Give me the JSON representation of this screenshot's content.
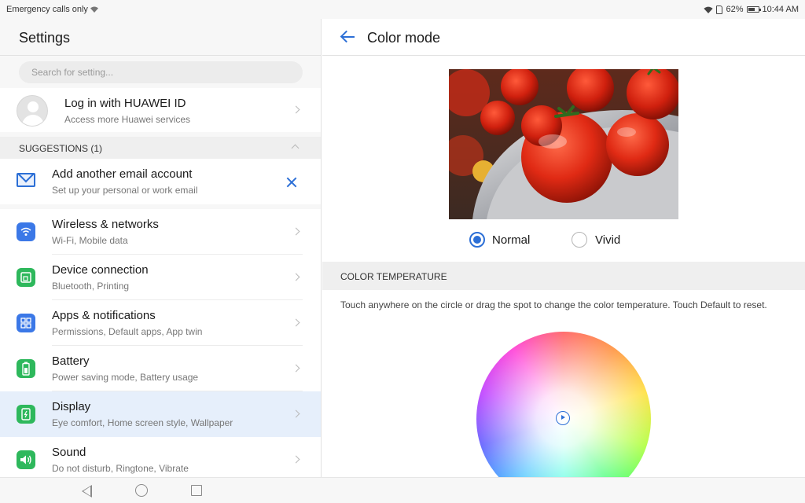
{
  "status_bar": {
    "left_text": "Emergency calls only",
    "battery": "62%",
    "time": "10:44 AM"
  },
  "left_pane": {
    "title": "Settings",
    "search_placeholder": "Search for setting...",
    "account": {
      "title": "Log in with HUAWEI ID",
      "subtitle": "Access more Huawei services"
    },
    "suggestions": {
      "header": "SUGGESTIONS (1)",
      "items": [
        {
          "title": "Add another email account",
          "subtitle": "Set up your personal or work email"
        }
      ]
    },
    "menu": [
      {
        "title": "Wireless & networks",
        "subtitle": "Wi-Fi, Mobile data",
        "icon": "wifi-icon",
        "color": "#3b78e7"
      },
      {
        "title": "Device connection",
        "subtitle": "Bluetooth, Printing",
        "icon": "device-connection-icon",
        "color": "#2eb85c"
      },
      {
        "title": "Apps & notifications",
        "subtitle": "Permissions, Default apps, App twin",
        "icon": "apps-icon",
        "color": "#3b78e7"
      },
      {
        "title": "Battery",
        "subtitle": "Power saving mode, Battery usage",
        "icon": "battery-icon",
        "color": "#2eb85c"
      },
      {
        "title": "Display",
        "subtitle": "Eye comfort, Home screen style, Wallpaper",
        "icon": "display-icon",
        "color": "#2eb85c",
        "selected": true
      },
      {
        "title": "Sound",
        "subtitle": "Do not disturb, Ringtone, Vibrate",
        "icon": "sound-icon",
        "color": "#2eb85c"
      }
    ]
  },
  "right_pane": {
    "title": "Color mode",
    "preview_image": "tomatoes-in-colander",
    "color_mode_options": [
      {
        "label": "Normal",
        "selected": true
      },
      {
        "label": "Vivid",
        "selected": false
      }
    ],
    "color_temperature": {
      "header": "COLOR TEMPERATURE",
      "description": "Touch anywhere on the circle or drag the spot to change the color temperature. Touch Default to reset."
    }
  },
  "colors": {
    "accent": "#2c6fd6",
    "selected_row": "#e6effb",
    "pane_bg": "#f7f7f7"
  }
}
